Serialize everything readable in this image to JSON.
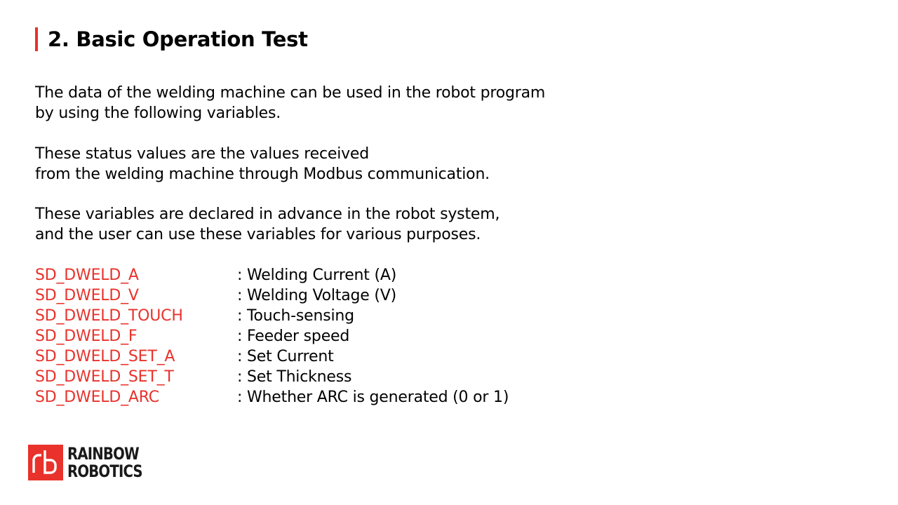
{
  "title": "2. Basic Operation Test",
  "paragraphs": [
    {
      "lines": [
        "The data of the welding machine can be used in the robot program",
        "by using the following variables."
      ]
    },
    {
      "lines": [
        "These status values are the values received",
        "from the welding machine through Modbus communication."
      ]
    },
    {
      "lines": [
        "These variables are declared in advance in the robot system,",
        "and the user can use these variables for various purposes."
      ]
    }
  ],
  "variables": [
    {
      "name": "SD_DWELD_A",
      "desc": ": Welding Current (A)"
    },
    {
      "name": "SD_DWELD_V",
      "desc": ": Welding Voltage (V)"
    },
    {
      "name": "SD_DWELD_TOUCH",
      "desc": ": Touch-sensing"
    },
    {
      "name": "SD_DWELD_F",
      "desc": ": Feeder speed"
    },
    {
      "name": "SD_DWELD_SET_A",
      "desc": ": Set Current"
    },
    {
      "name": "SD_DWELD_SET_T",
      "desc": ": Set Thickness"
    },
    {
      "name": "SD_DWELD_ARC",
      "desc": ": Whether ARC is generated (0 or 1)"
    }
  ],
  "logo": {
    "line1": "RAINBOW",
    "line2": "ROBOTICS"
  },
  "colors": {
    "accent": "#e8322b",
    "text": "#000000"
  }
}
